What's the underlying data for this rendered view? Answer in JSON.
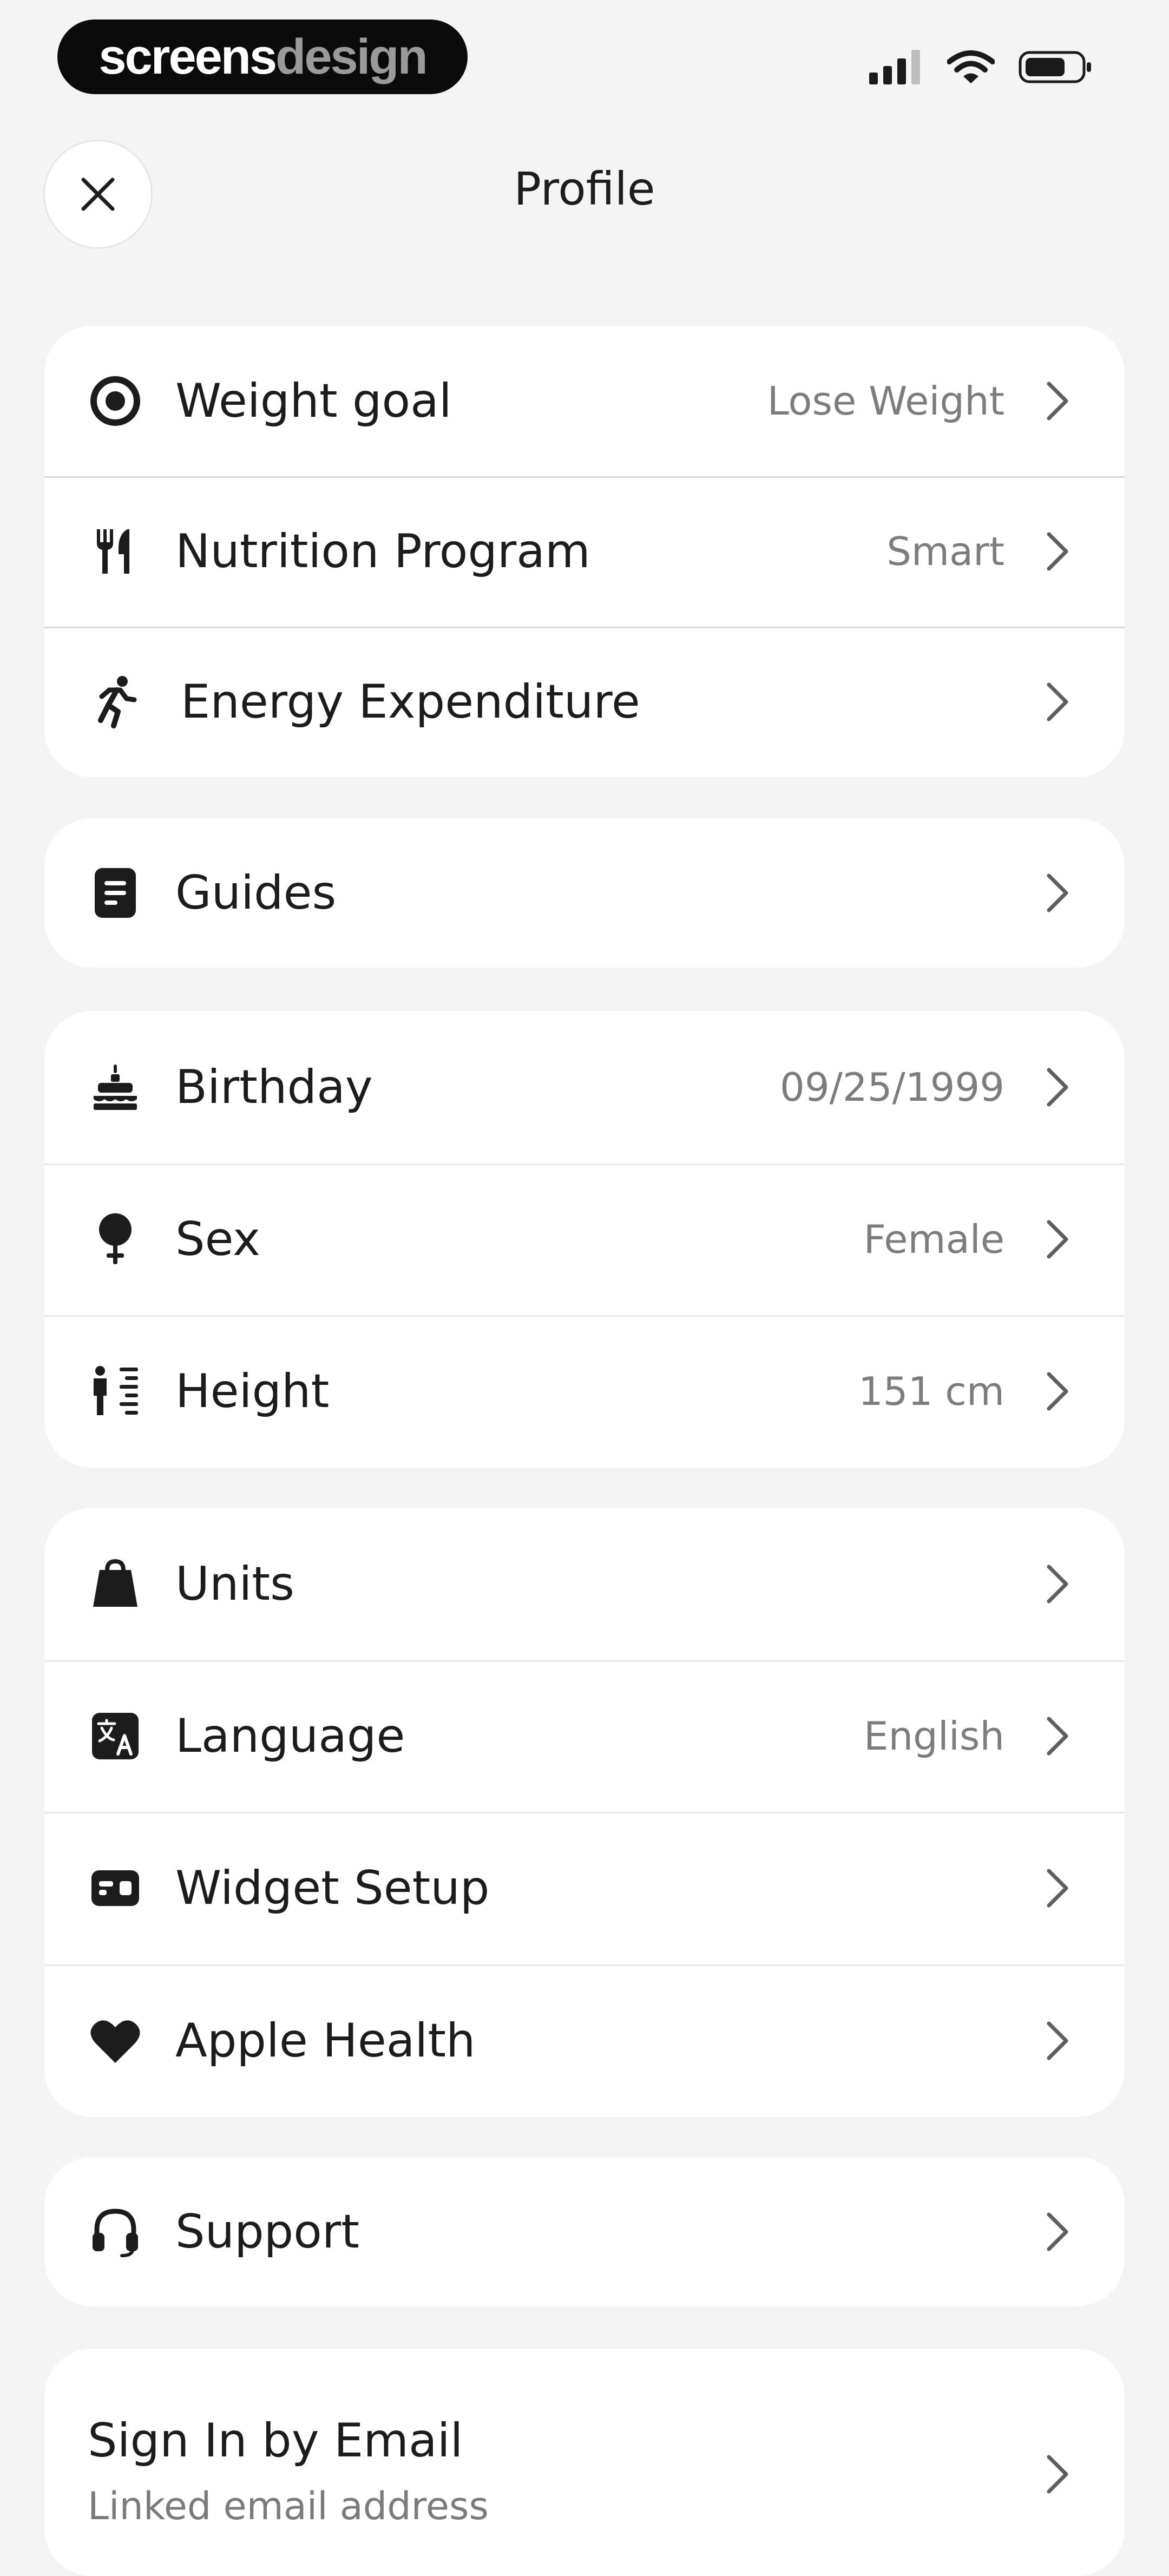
{
  "status_bar": {
    "brand_part1": "screens",
    "brand_part2": "design"
  },
  "header": {
    "title": "Profile"
  },
  "group_goals": [
    {
      "label": "Weight goal",
      "value": "Lose Weight",
      "icon": "target-icon"
    },
    {
      "label": "Nutrition Program",
      "value": "Smart",
      "icon": "utensils-icon"
    },
    {
      "label": "Energy Expenditure",
      "value": "",
      "icon": "running-person-icon"
    }
  ],
  "group_guides": [
    {
      "label": "Guides",
      "value": "",
      "icon": "document-icon"
    }
  ],
  "group_personal": [
    {
      "label": "Birthday",
      "value": "09/25/1999",
      "icon": "cake-icon"
    },
    {
      "label": "Sex",
      "value": "Female",
      "icon": "female-symbol-icon"
    },
    {
      "label": "Height",
      "value": "151 cm",
      "icon": "height-ruler-icon"
    }
  ],
  "group_settings": [
    {
      "label": "Units",
      "value": "",
      "icon": "weight-bag-icon"
    },
    {
      "label": "Language",
      "value": "English",
      "icon": "translate-icon"
    },
    {
      "label": "Widget Setup",
      "value": "",
      "icon": "widget-icon"
    },
    {
      "label": "Apple Health",
      "value": "",
      "icon": "heart-icon"
    }
  ],
  "group_support": [
    {
      "label": "Support",
      "value": "",
      "icon": "headphones-icon"
    }
  ],
  "sign_in": {
    "label": "Sign In by Email",
    "subtitle": "Linked email address"
  },
  "colors": {
    "background": "#f4f4f4",
    "card": "#ffffff",
    "text": "#1c1c1c",
    "secondary": "#7d7d7d",
    "chevron": "#5e5e5e"
  }
}
